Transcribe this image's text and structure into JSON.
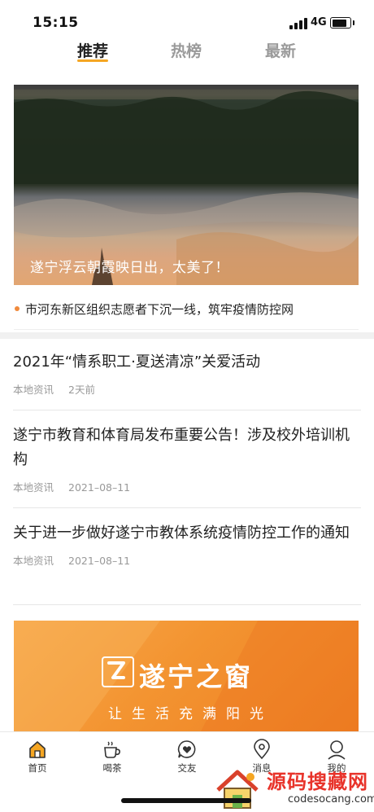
{
  "status_bar": {
    "time": "15:15",
    "network": "4G",
    "battery_level": 0.85
  },
  "top_tabs": [
    {
      "label": "推荐",
      "active": true
    },
    {
      "label": "热榜",
      "active": false
    },
    {
      "label": "最新",
      "active": false
    }
  ],
  "hero": {
    "caption": "遂宁浮云朝霞映日出，太美了！"
  },
  "headline": {
    "text": "市河东新区组织志愿者下沉一线，筑牢疫情防控网"
  },
  "news": [
    {
      "title": "2021年“情系职工·夏送清凉”关爱活动",
      "source": "本地资讯",
      "time": "2天前"
    },
    {
      "title": "遂宁市教育和体育局发布重要公告！涉及校外培训机构",
      "source": "本地资讯",
      "time": "2021–08–11"
    },
    {
      "title": "关于进一步做好遂宁市教体系统疫情防控工作的通知",
      "source": "本地资讯",
      "time": "2021–08–11"
    }
  ],
  "banner": {
    "logo_text": "遂宁之窗",
    "slogan": "让生活充满阳光"
  },
  "tabbar": [
    {
      "label": "首页",
      "icon": "home-icon",
      "active": true
    },
    {
      "label": "喝茶",
      "icon": "tea-cup-icon",
      "active": false
    },
    {
      "label": "交友",
      "icon": "heart-chat-icon",
      "active": false
    },
    {
      "label": "消息",
      "icon": "location-pin-icon",
      "active": false
    },
    {
      "label": "我的",
      "icon": "user-icon",
      "active": false
    }
  ],
  "watermark": {
    "text": "源码搜藏网",
    "url": "codesocang.com"
  },
  "colors": {
    "accent": "#f5a623",
    "banner": "#f39431",
    "watermark": "#e8332a"
  }
}
